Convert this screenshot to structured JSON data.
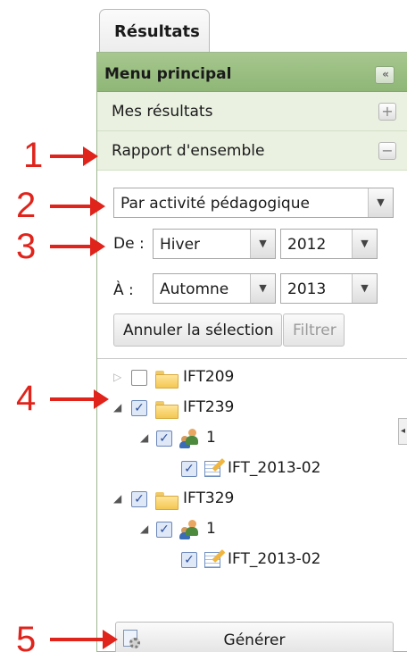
{
  "tab": {
    "label": "Résultats"
  },
  "menu": {
    "title": "Menu principal",
    "collapse_glyph": "«",
    "sections": [
      {
        "label": "Mes résultats",
        "toggle": "+"
      },
      {
        "label": "Rapport d'ensemble",
        "toggle": "−"
      }
    ]
  },
  "filters": {
    "grouping": "Par activité pédagogique",
    "from_label": "De :",
    "from_season": "Hiver",
    "from_year": "2012",
    "to_label": "À :",
    "to_season": "Automne",
    "to_year": "2013",
    "clear_button": "Annuler la sélection",
    "filter_button": "Filtrer"
  },
  "tree": {
    "items": [
      {
        "label": "IFT209",
        "checked": false,
        "expanded": false
      },
      {
        "label": "IFT239",
        "checked": true,
        "expanded": true,
        "group": "1",
        "activity": "IFT_2013-02"
      },
      {
        "label": "IFT329",
        "checked": true,
        "expanded": true,
        "group": "1",
        "activity": "IFT_2013-02"
      }
    ]
  },
  "generate_button": "Générer",
  "annotations": [
    "1",
    "2",
    "3",
    "4",
    "5"
  ],
  "colors": {
    "header": "#8fb677",
    "annotation": "#e0231b"
  }
}
